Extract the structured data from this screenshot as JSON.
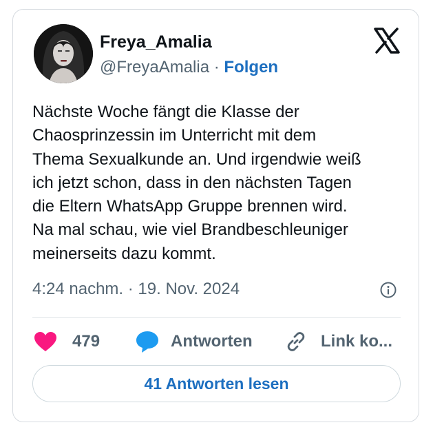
{
  "author": {
    "display_name": "Freya_Amalia",
    "handle": "@FreyaAmalia",
    "separator": "·",
    "follow_label": "Folgen"
  },
  "tweet": {
    "lines": [
      "Nächste Woche fängt die Klasse der",
      "Chaosprinzessin im Unterricht mit dem",
      "Thema Sexualkunde an. Und irgendwie weiß",
      "ich jetzt schon, dass in den nächsten Tagen",
      "die Eltern WhatsApp Gruppe brennen wird.",
      "Na mal schau, wie viel Brandbeschleuniger",
      "meinerseits dazu kommt."
    ],
    "timestamp": "4:24 nachm. · 19. Nov. 2024"
  },
  "actions": {
    "like_count": "479",
    "reply_label": "Antworten",
    "copy_link_label": "Link ko..."
  },
  "read_replies_label": "41 Antworten lesen",
  "icons": {
    "logo": "x-logo-icon",
    "info": "info-icon",
    "like": "heart-icon",
    "reply": "speech-bubble-icon",
    "link": "link-icon"
  },
  "colors": {
    "heart": "#f91880",
    "reply_bubble": "#1d9bf0",
    "link_blue": "#1d6fc0",
    "text_secondary": "#536471"
  }
}
